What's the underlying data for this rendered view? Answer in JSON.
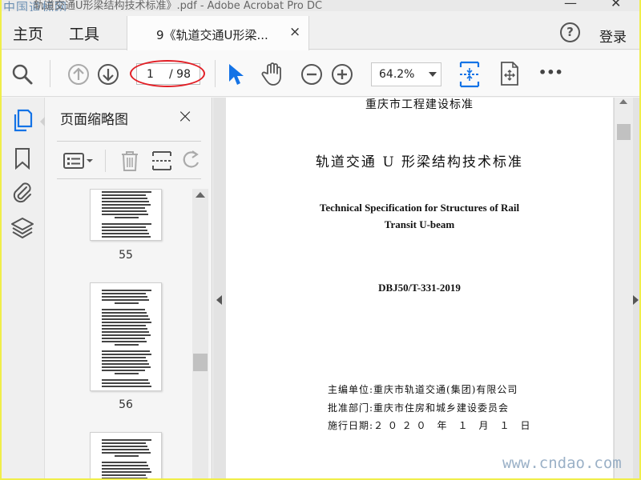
{
  "window": {
    "title_fragment": "轨道交通U形梁结构技术标准》.pdf - Adobe Acrobat Pro DC",
    "watermark_top": "中国道标网"
  },
  "menu": {
    "home": "主页",
    "tools": "工具",
    "tab_label": "9《轨道交通U形梁...",
    "tab_close": "×",
    "help": "?",
    "sign_in": "登录"
  },
  "toolbar": {
    "current_page": "1",
    "total_pages": "/ 98",
    "zoom": "64.2%",
    "more": "•••",
    "highlight_color": "#e21f26",
    "accent_color": "#1473e6"
  },
  "thumbnail_panel": {
    "title": "页面缩略图",
    "close": "×",
    "pages": [
      {
        "number": "55"
      },
      {
        "number": "56"
      }
    ]
  },
  "document": {
    "header": "重庆市工程建设标准",
    "title_cn": "轨道交通 U 形梁结构技术标准",
    "title_en_line1": "Technical Specification for Structures of Rail",
    "title_en_line2": "Transit U-beam",
    "code": "DBJ50/T-331-2019",
    "editor": "主编单位:重庆市轨道交通(集团)有限公司",
    "approver": "批准部门:重庆市住房和城乡建设委员会",
    "effective": "施行日期:２ ０ ２ ０　年　１　月　１　日"
  },
  "site_watermark": "www.cndao.com"
}
